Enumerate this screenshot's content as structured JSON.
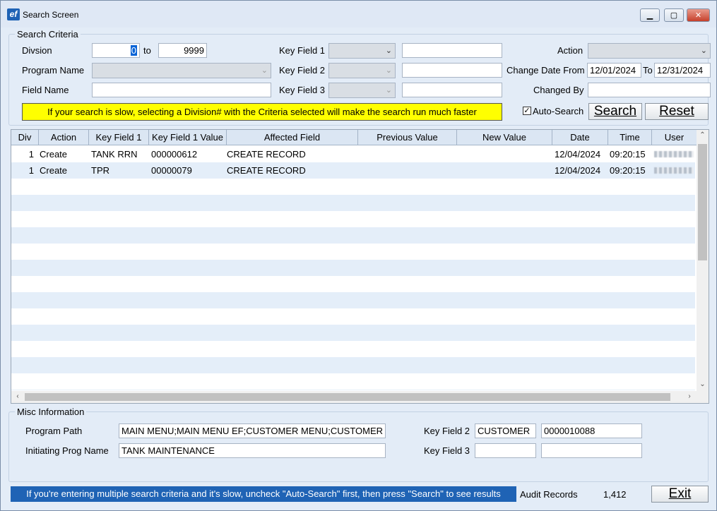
{
  "window": {
    "title": "Search Screen",
    "app_icon": "ef",
    "minimize_glyph": "▁",
    "maximize_glyph": "▢",
    "close_glyph": "✕"
  },
  "search_criteria": {
    "group_label": "Search Criteria",
    "division_label": "Divsion",
    "division_from": "0",
    "division_to_label": "to",
    "division_to": "9999",
    "program_name_label": "Program Name",
    "program_name_value": "",
    "field_name_label": "Field Name",
    "field_name_value": "",
    "key_field_1_label": "Key Field 1",
    "key_field_2_label": "Key Field 2",
    "key_field_3_label": "Key Field 3",
    "key_field_1_value": "",
    "key_field_2_value": "",
    "key_field_3_value": "",
    "action_label": "Action",
    "action_value": "",
    "change_date_from_label": "Change Date From",
    "change_date_from": "12/01/2024",
    "change_date_to_label": "To",
    "change_date_to": "12/31/2024",
    "changed_by_label": "Changed By",
    "changed_by_value": "",
    "banner": "If your search is slow, selecting a Division# with the Criteria selected will make the search run much faster",
    "auto_search_label": "Auto-Search",
    "auto_search_checked": true,
    "search_button": "Search",
    "reset_button": "Reset"
  },
  "grid": {
    "columns": [
      "Div",
      "Action",
      "Key Field 1",
      "Key Field 1 Value",
      "Affected Field",
      "Previous Value",
      "New Value",
      "Date",
      "Time",
      "User"
    ],
    "rows": [
      {
        "div": "1",
        "action": "Create",
        "key_field_1": "TANK RRN",
        "key_field_1_value": "000000612",
        "affected_field": "CREATE RECORD",
        "previous_value": "",
        "new_value": "",
        "date": "12/04/2024",
        "time": "09:20:15"
      },
      {
        "div": "1",
        "action": "Create",
        "key_field_1": "TPR",
        "key_field_1_value": "00000079",
        "affected_field": "CREATE RECORD",
        "previous_value": "",
        "new_value": "",
        "date": "12/04/2024",
        "time": "09:20:15"
      }
    ]
  },
  "misc": {
    "group_label": "Misc Information",
    "program_path_label": "Program Path",
    "program_path": "MAIN MENU;MAIN MENU EF;CUSTOMER MENU;CUSTOMER",
    "initiating_prog_label": "Initiating Prog Name",
    "initiating_prog": "TANK MAINTENANCE",
    "key_field_2_label": "Key Field 2",
    "key_field_2_name": "CUSTOMER",
    "key_field_2_value": "0000010088",
    "key_field_3_label": "Key Field 3",
    "key_field_3_name": "",
    "key_field_3_value": ""
  },
  "footer": {
    "status_text": "If you're entering multiple search criteria and it's slow, uncheck \"Auto-Search\" first, then press \"Search\" to see results",
    "audit_records_label": "Audit Records",
    "audit_records_count": "1,412",
    "exit_button": "Exit"
  },
  "colors": {
    "banner_yellow": "#ffff00",
    "status_blue": "#1f63b5",
    "alt_row": "#e4eef9"
  }
}
